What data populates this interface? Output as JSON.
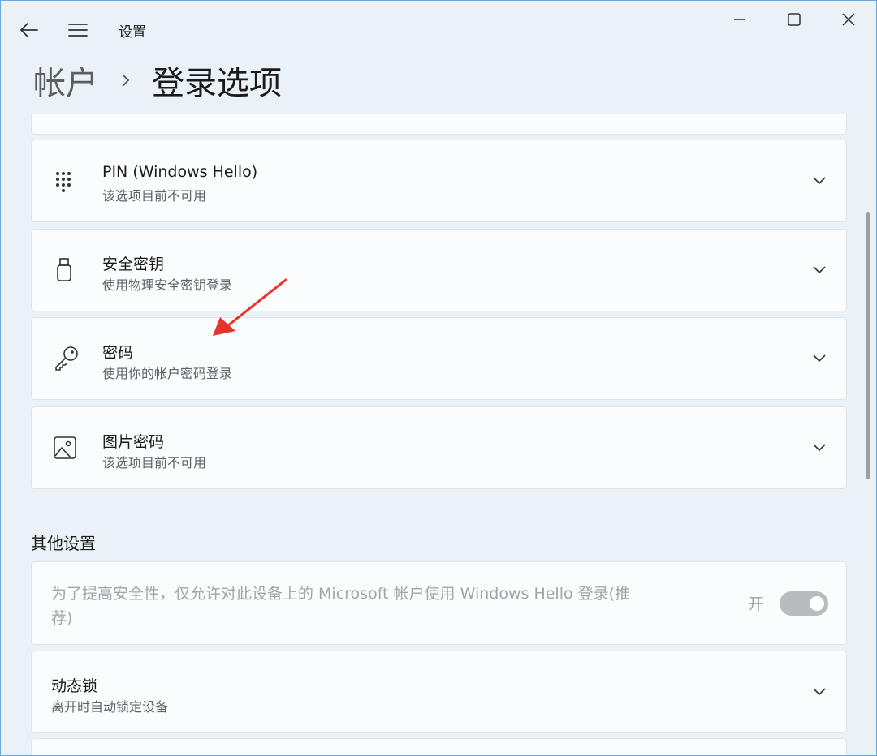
{
  "window": {
    "app_title": "设置"
  },
  "breadcrumb": {
    "parent": "帐户",
    "current": "登录选项"
  },
  "options": [
    {
      "icon": "pin-keypad-icon",
      "title": "PIN (Windows Hello)",
      "subtitle": "该选项目前不可用"
    },
    {
      "icon": "security-key-icon",
      "title": "安全密钥",
      "subtitle": "使用物理安全密钥登录"
    },
    {
      "icon": "key-icon",
      "title": "密码",
      "subtitle": "使用你的帐户密码登录"
    },
    {
      "icon": "picture-icon",
      "title": "图片密码",
      "subtitle": "该选项目前不可用"
    }
  ],
  "other_settings": {
    "heading": "其他设置",
    "hello_only": {
      "text": "为了提高安全性，仅允许对此设备上的 Microsoft 帐户使用 Windows Hello 登录(推荐)",
      "toggle_label": "开",
      "toggle_on": true,
      "disabled": true
    },
    "dynamic_lock": {
      "title": "动态锁",
      "subtitle": "离开时自动锁定设备"
    }
  },
  "colors": {
    "annotation_arrow": "#e8322c",
    "window_border": "#6aa6d8",
    "background": "#eaf2f7"
  }
}
